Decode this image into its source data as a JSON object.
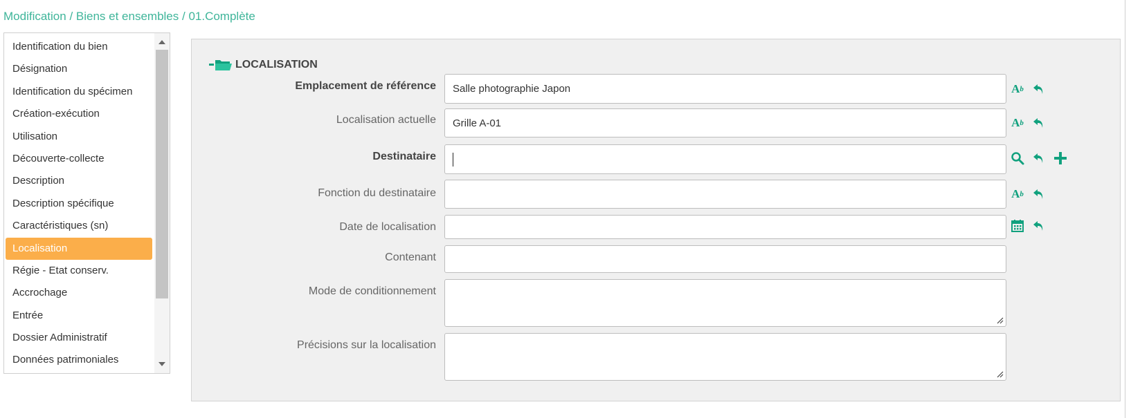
{
  "breadcrumb": {
    "items": [
      "Modification",
      "Biens et ensembles",
      "01.Complète"
    ],
    "separator": " / "
  },
  "sidebar": {
    "items": [
      {
        "label": "Identification du bien"
      },
      {
        "label": "Désignation"
      },
      {
        "label": "Identification du spécimen"
      },
      {
        "label": "Création-exécution"
      },
      {
        "label": "Utilisation"
      },
      {
        "label": "Découverte-collecte"
      },
      {
        "label": "Description"
      },
      {
        "label": "Description spécifique"
      },
      {
        "label": "Caractéristiques (sn)"
      },
      {
        "label": "Localisation",
        "active": true
      },
      {
        "label": "Régie - Etat conserv."
      },
      {
        "label": "Accrochage"
      },
      {
        "label": "Entrée"
      },
      {
        "label": "Dossier Administratif"
      },
      {
        "label": "Données patrimoniales"
      }
    ]
  },
  "section": {
    "title": "LOCALISATION",
    "icon": "folder-open-icon"
  },
  "form": {
    "emplacement": {
      "label": "Emplacement de référence",
      "value": "Salle photographie Japon"
    },
    "localisation_actuelle": {
      "label": "Localisation actuelle",
      "value": "Grille A-01"
    },
    "destinataire": {
      "label": "Destinataire",
      "value": ""
    },
    "fonction": {
      "label": "Fonction du destinataire",
      "value": ""
    },
    "date": {
      "label": "Date de localisation",
      "value": ""
    },
    "contenant": {
      "label": "Contenant",
      "value": ""
    },
    "mode": {
      "label": "Mode de conditionnement",
      "value": ""
    },
    "precisions": {
      "label": "Précisions sur la localisation",
      "value": ""
    }
  },
  "icons": {
    "spellcheck": "A",
    "spellcheck_sup": "b"
  },
  "colors": {
    "accent": "#3fb59a",
    "icon_green": "#11a17e",
    "active_bg": "#fbae4a"
  }
}
